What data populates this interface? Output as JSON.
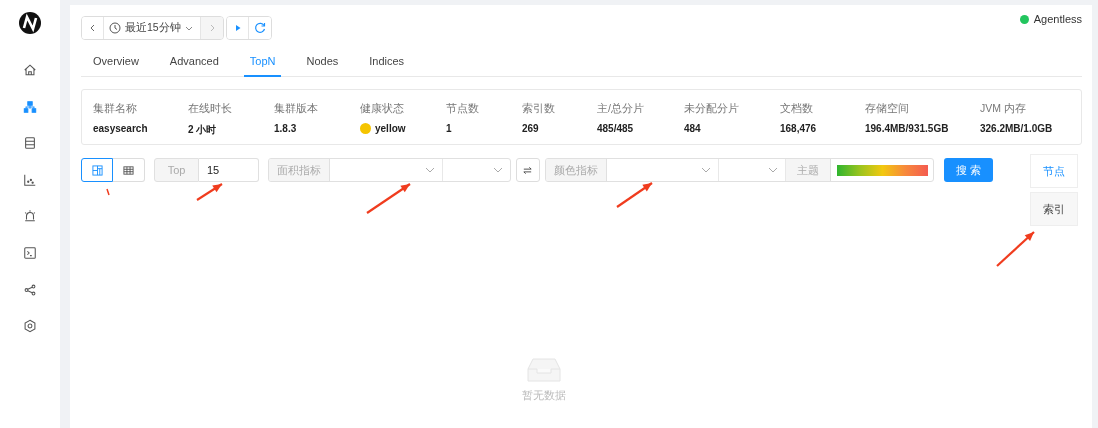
{
  "sidebar": {
    "items": [
      {
        "kind": "home",
        "selected": false
      },
      {
        "kind": "cluster",
        "selected": true
      },
      {
        "kind": "database",
        "selected": false
      },
      {
        "kind": "chart",
        "selected": false
      },
      {
        "kind": "alarm",
        "selected": false
      },
      {
        "kind": "terminal",
        "selected": false
      },
      {
        "kind": "share",
        "selected": false
      },
      {
        "kind": "settings",
        "selected": false
      }
    ]
  },
  "time_picker": {
    "label": "最近15分钟"
  },
  "status": {
    "label": "Agentless"
  },
  "tabs": [
    {
      "label": "Overview",
      "selected": false
    },
    {
      "label": "Advanced",
      "selected": false
    },
    {
      "label": "TopN",
      "selected": true
    },
    {
      "label": "Nodes",
      "selected": false
    },
    {
      "label": "Indices",
      "selected": false
    }
  ],
  "cluster_stats": [
    {
      "label": "集群名称",
      "value": "easysearch"
    },
    {
      "label": "在线时长",
      "value": "2 小时"
    },
    {
      "label": "集群版本",
      "value": "1.8.3"
    },
    {
      "label": "健康状态",
      "value": "yellow",
      "color": "#f5c400"
    },
    {
      "label": "节点数",
      "value": "1"
    },
    {
      "label": "索引数",
      "value": "269"
    },
    {
      "label": "主/总分片",
      "value": "485/485"
    },
    {
      "label": "未分配分片",
      "value": "484"
    },
    {
      "label": "文档数",
      "value": "168,476"
    },
    {
      "label": "存储空间",
      "value": "196.4MB/931.5GB"
    },
    {
      "label": "JVM 内存",
      "value": "326.2MB/1.0GB"
    }
  ],
  "view_toggle": [
    {
      "kind": "treemap",
      "selected": true
    },
    {
      "kind": "table",
      "selected": false
    }
  ],
  "filters": {
    "top_label": "Top",
    "top_value": "15",
    "area_label": "面积指标",
    "color_label": "颜色指标",
    "theme_label": "主题",
    "search_button": "搜 索"
  },
  "side_tabs": [
    {
      "label": "节点",
      "selected": true
    },
    {
      "label": "索引",
      "selected": false
    }
  ],
  "empty_state": {
    "text": "暂无数据"
  }
}
